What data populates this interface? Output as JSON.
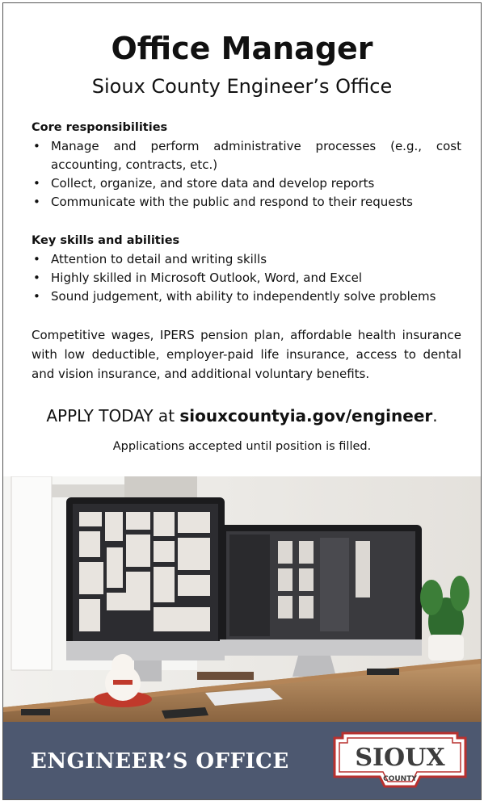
{
  "title": "Office Manager",
  "subtitle": "Sioux County Engineer’s Office",
  "core": {
    "heading": "Core responsibilities",
    "items": [
      "Manage and perform administrative processes (e.g., cost accounting, contracts, etc.)",
      "Collect, organize, and store data and develop reports",
      "Communicate with the public and respond to their requests"
    ]
  },
  "skills": {
    "heading": "Key skills and abilities",
    "items": [
      "Attention to detail and writing skills",
      "Highly skilled in Microsoft Outlook, Word, and Excel",
      "Sound judgement, with ability to independently solve problems"
    ]
  },
  "benefits": "Competitive wages, IPERS pension plan, affordable health insurance with low deductible, employer-paid life insurance, access to dental and vision insurance, and additional voluntary benefits.",
  "apply": {
    "prefix": "APPLY TODAY at ",
    "url": "siouxcountyia.gov/engineer",
    "suffix": "."
  },
  "accepted": "Applications accepted until position is filled.",
  "footer": {
    "text": "ENGINEER’S OFFICE",
    "logo_main": "SIOUX",
    "logo_sub": "COUNTY"
  },
  "colors": {
    "footer_bg": "#4d5870",
    "logo_red": "#b8312f"
  },
  "bullet": "•"
}
